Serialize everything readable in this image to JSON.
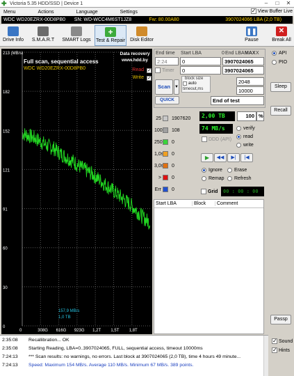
{
  "window": {
    "title": "Victoria 5.35 HDD/SSD | Device 1",
    "minimize": "–",
    "maximize": "□",
    "close": "✕"
  },
  "menu": {
    "items": [
      "Menu",
      "Actions",
      "Language",
      "Settings"
    ],
    "live_label": "View Buffer Live",
    "live_checked": true
  },
  "infobar": {
    "model": "WDC WD20EZRX-00D8PB0",
    "serial": "SN: WD-WCC4M6ST1JZ8",
    "firmware": "Fw: 80.00A80",
    "lba": "3907024066 LBA (2,0 TB)"
  },
  "toolbar": {
    "buttons": [
      {
        "label": "Drive Info",
        "icon": "drive-info-icon",
        "color": "#3a76c4"
      },
      {
        "label": "S.M.A.R.T",
        "icon": "smart-icon",
        "color": "#6b6b6b"
      },
      {
        "label": "SMART Logs",
        "icon": "smart-logs-icon",
        "color": "#8a8a8a"
      },
      {
        "label": "Test & Repair",
        "icon": "test-repair-icon",
        "color": "#3caa3c"
      },
      {
        "label": "Disk Editor",
        "icon": "disk-editor-icon",
        "color": "#d08a2a"
      }
    ],
    "pause": "Pause",
    "break_all": "Break All"
  },
  "graph": {
    "title": "Full scan, sequential access",
    "subtitle": "WDC WD20EZRX-00D8PB0",
    "watermark_line1": "Data recovery",
    "watermark_line2": "www.hdd.by",
    "read_label": "Read",
    "write_label": "Write",
    "read_color": "#e03030",
    "write_color": "#e8c400",
    "cursor_speed": "157,9 MB/s",
    "cursor_pos": "1,0 TB"
  },
  "chart_data": {
    "type": "line",
    "ylabel": "(MB/s)",
    "y_ticks": [
      "213 (MB/s)",
      "182",
      "152",
      "121",
      "91",
      "60",
      "30",
      "0"
    ],
    "x_ticks": [
      "0",
      "308G",
      "616G",
      "923G",
      "1,2T",
      "1,5T",
      "1,8T"
    ],
    "ylim": [
      0,
      213
    ],
    "xlim": [
      0,
      2.0
    ],
    "series": [
      {
        "values_x": [
          0,
          0.1,
          0.2,
          0.3,
          0.4,
          0.5,
          0.6,
          0.7,
          0.8,
          0.9,
          1.0,
          1.1,
          1.2,
          1.3,
          1.4,
          1.5,
          1.6,
          1.7,
          1.8,
          1.9,
          2.0
        ],
        "values_y": [
          150,
          148,
          146,
          143,
          140,
          138,
          134,
          131,
          128,
          124,
          121,
          118,
          114,
          110,
          106,
          102,
          98,
          94,
          89,
          84,
          80
        ]
      }
    ]
  },
  "params": {
    "end_time_label": "End time",
    "start_lba_label": "Start LBA",
    "end_lba_label": "End LBA",
    "max_label": "MAX",
    "end_time_value": "2:24",
    "start_lba_value": "0",
    "end_lba_value": "3907024065",
    "current_lba_value": "3907024065",
    "timer_label": "Timer",
    "timer_value": "0",
    "block_size_label": "block size",
    "auto_label": "auto",
    "timeout_label": "timeout,ms",
    "block_size_value": "2048",
    "timeout_value": "10000",
    "end_of_test": "End of test",
    "scan_button": "Scan",
    "quick_button": "QUICK",
    "zero_button": "0",
    "x_button": "X"
  },
  "blocks": [
    {
      "label": "25",
      "color": "#c8c8c8",
      "count": "1907620"
    },
    {
      "label": "100",
      "color": "#a0a0a0",
      "count": "108"
    },
    {
      "label": "250",
      "color": "#3ad43a",
      "count": "0"
    },
    {
      "label": "1,0s",
      "color": "#f0a020",
      "count": "0"
    },
    {
      "label": "3,0s",
      "color": "#e07010",
      "count": "0"
    },
    {
      "label": ">",
      "color": "#e01010",
      "count": "0"
    },
    {
      "label": "Err",
      "color": "#2050d0",
      "count": "0"
    }
  ],
  "status": {
    "capacity": "2,00 TB",
    "percent": "100",
    "percent_sign": "%",
    "speed": "74 MB/s",
    "verify": "verify",
    "read": "read",
    "write": "write",
    "ddd": "DDD (API)",
    "ignore": "Ignore",
    "erase": "Erase",
    "remap": "Remap",
    "refresh": "Refresh",
    "grid": "Grid",
    "grid_time": "00 : 00 : 00"
  },
  "side": {
    "api": "API",
    "pio": "PIO",
    "sleep": "Sleep",
    "recall": "Recall",
    "passp": "Passp"
  },
  "table": {
    "columns": [
      "Start LBA",
      "Block",
      "Comment"
    ]
  },
  "log": [
    {
      "time": "2:35:08",
      "msg": "Recallibration... OK",
      "blue": false
    },
    {
      "time": "2:35:08",
      "msg": "Starting Reading, LBA=0..3907024065, FULL, sequential access, timeout 10000ms",
      "blue": false
    },
    {
      "time": "7:24:13",
      "msg": "*** Scan results: no warnings, no errors. Last block at 3907024065 (2,0 TB), time 4 hours 49 minute...",
      "blue": false
    },
    {
      "time": "7:24:13",
      "msg": "Speed: Maximum 154 MB/s. Average 110 MB/s. Minimum 67 MB/s. 389 points.",
      "blue": true
    }
  ],
  "bottom": {
    "sound": "Sound",
    "hints": "Hints"
  }
}
